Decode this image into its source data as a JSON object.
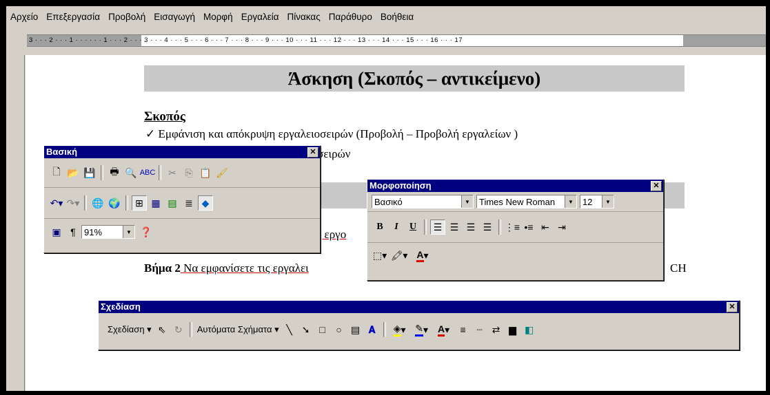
{
  "menu": [
    "Αρχείο",
    "Επεξεργασία",
    "Προβολή",
    "Εισαγωγή",
    "Μορφή",
    "Εργαλεία",
    "Πίνακας",
    "Παράθυρο",
    "Βοήθεια"
  ],
  "ruler_text": "3 · · · 2 · · · 1 · · ·   · · · 1 · · · 2 · · · 3 · · · 4 · · · 5 · · · 6 · · · 7 · · · 8 · · · 9 · · · 10 · · · 11 · · · 12 · · · 13 · · · 14 · · · 15 · · · 16 · · · 17",
  "document": {
    "heading": "Άσκηση  (Σκοπός – αντικείμενο)",
    "scope_label": "Σκοπός",
    "bullet1": "✓  Εμφάνιση και απόκρυψη εργαλειοσειρών (Προβολή – Προβολή εργαλείων )",
    "bullet2": "ειοσειρών",
    "step1_tail": "ις εργο",
    "step2_bold": "Βήμα 2",
    "step2_text": " Να εμφανίσετε τις εργαλει",
    "step2_end": "CH"
  },
  "toolbars": {
    "standard": {
      "title": "Βασική",
      "zoom": "91%"
    },
    "formatting": {
      "title": "Μορφοποίηση",
      "style": "Βασικό",
      "font": "Times New Roman",
      "size": "12",
      "bold": "B",
      "italic": "I",
      "underline": "U"
    },
    "drawing": {
      "title": "Σχεδίαση",
      "draw_menu": "Σχεδίαση ▾",
      "autoshapes": "Αυτόματα Σχήματα ▾"
    }
  },
  "colors": {
    "titlebar": "#000080",
    "face": "#d4d0c8"
  }
}
